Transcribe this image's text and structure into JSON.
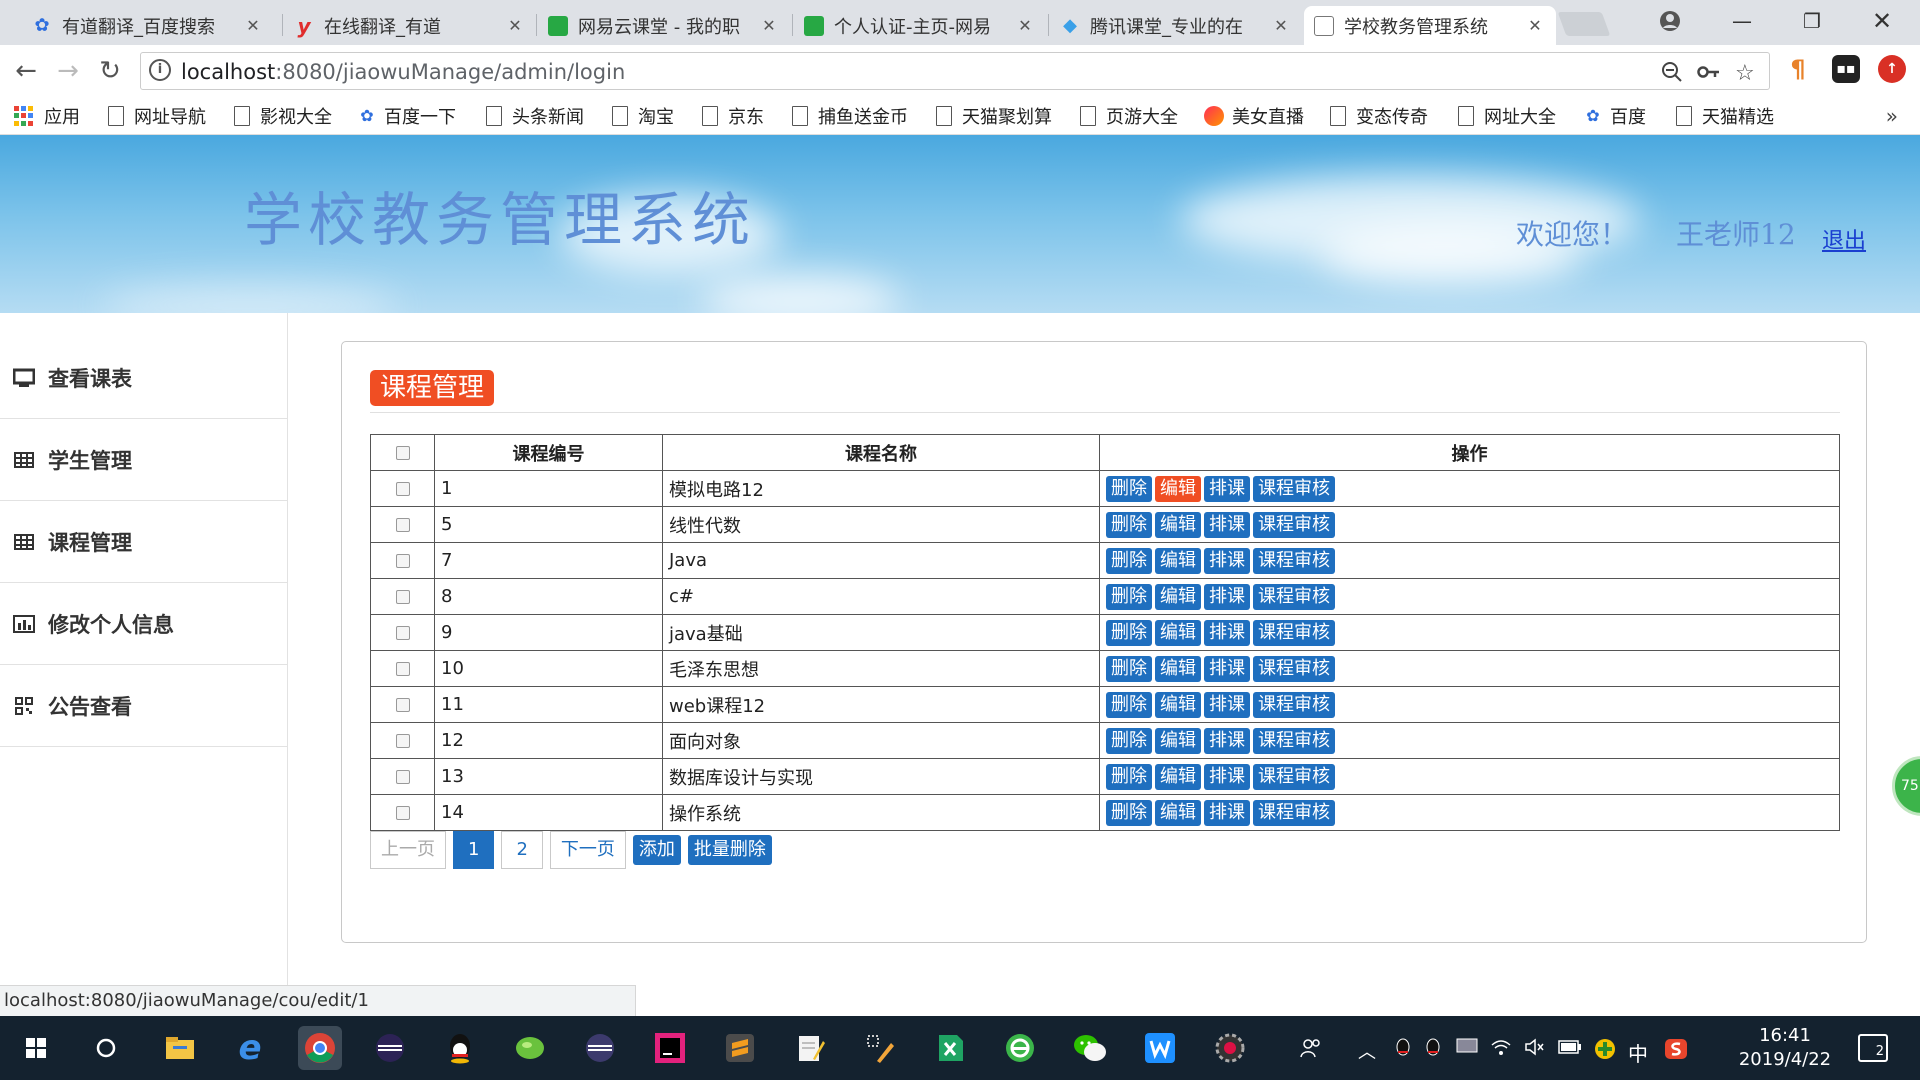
{
  "browser": {
    "tabs": [
      {
        "title": "有道翻译_百度搜索",
        "icon": "baidu-paw-icon",
        "color": "#2f6fde"
      },
      {
        "title": "在线翻译_有道",
        "icon": "youdao-icon",
        "color": "#e02d2d"
      },
      {
        "title": "网易云课堂 - 我的职",
        "icon": "netease-study-icon",
        "color": "#27a844"
      },
      {
        "title": "个人认证-主页-网易",
        "icon": "netease-study-icon",
        "color": "#27a844"
      },
      {
        "title": "腾讯课堂_专业的在",
        "icon": "tencent-class-icon",
        "color": "#3aa0e8"
      },
      {
        "title": "学校教务管理系统",
        "icon": "page-icon",
        "color": "#888888",
        "active": true
      }
    ],
    "url_host": "localhost",
    "url_rest": ":8080/jiaowuManage/admin/login",
    "bookmarks": [
      {
        "label": "应用",
        "icon": "apps-icon"
      },
      {
        "label": "网址导航",
        "icon": "page-icon"
      },
      {
        "label": "影视大全",
        "icon": "page-icon"
      },
      {
        "label": "百度一下",
        "icon": "baidu-paw-icon"
      },
      {
        "label": "头条新闻",
        "icon": "page-icon"
      },
      {
        "label": "淘宝",
        "icon": "page-icon"
      },
      {
        "label": "京东",
        "icon": "page-icon"
      },
      {
        "label": "捕鱼送金币",
        "icon": "page-icon"
      },
      {
        "label": "天猫聚划算",
        "icon": "page-icon"
      },
      {
        "label": "页游大全",
        "icon": "page-icon"
      },
      {
        "label": "美女直播",
        "icon": "live-icon"
      },
      {
        "label": "变态传奇",
        "icon": "page-icon"
      },
      {
        "label": "网址大全",
        "icon": "page-icon"
      },
      {
        "label": "百度",
        "icon": "baidu-paw-icon"
      },
      {
        "label": "天猫精选",
        "icon": "page-icon"
      }
    ],
    "more": "»",
    "status_url": "localhost:8080/jiaowuManage/cou/edit/1"
  },
  "header": {
    "system_name": "学校教务管理系统",
    "welcome": "欢迎您！",
    "user": "王老师12",
    "logout": "退出"
  },
  "sidebar": {
    "items": [
      {
        "label": "查看课表",
        "icon": "monitor-icon"
      },
      {
        "label": "学生管理",
        "icon": "table-icon"
      },
      {
        "label": "课程管理",
        "icon": "table-icon"
      },
      {
        "label": "修改个人信息",
        "icon": "bar-chart-icon"
      },
      {
        "label": "公告查看",
        "icon": "qrcode-icon"
      }
    ]
  },
  "main": {
    "title": "课程管理",
    "columns": [
      "课程编号",
      "课程名称",
      "操作"
    ],
    "actions": [
      "删除",
      "编辑",
      "排课",
      "课程审核"
    ],
    "rows": [
      {
        "id": "1",
        "name": "模拟电路12",
        "highlight": "编辑"
      },
      {
        "id": "5",
        "name": "线性代数"
      },
      {
        "id": "7",
        "name": "Java"
      },
      {
        "id": "8",
        "name": "c#"
      },
      {
        "id": "9",
        "name": "java基础"
      },
      {
        "id": "10",
        "name": "毛泽东思想"
      },
      {
        "id": "11",
        "name": "web课程12"
      },
      {
        "id": "12",
        "name": "面向对象"
      },
      {
        "id": "13",
        "name": "数据库设计与实现"
      },
      {
        "id": "14",
        "name": "操作系统"
      }
    ],
    "pager": {
      "prev": "上一页",
      "pages": [
        "1",
        "2"
      ],
      "current": "1",
      "next": "下一页"
    },
    "add": "添加",
    "batch_delete": "批量删除"
  },
  "floating_ball": "75",
  "taskbar": {
    "ime": "中",
    "time": "16:41",
    "date": "2019/4/22",
    "notifications": "2"
  },
  "colors": {
    "primary_button": "#1f6fbf",
    "accent_orange": "#f04e23",
    "header_text": "#5f8fd6"
  }
}
